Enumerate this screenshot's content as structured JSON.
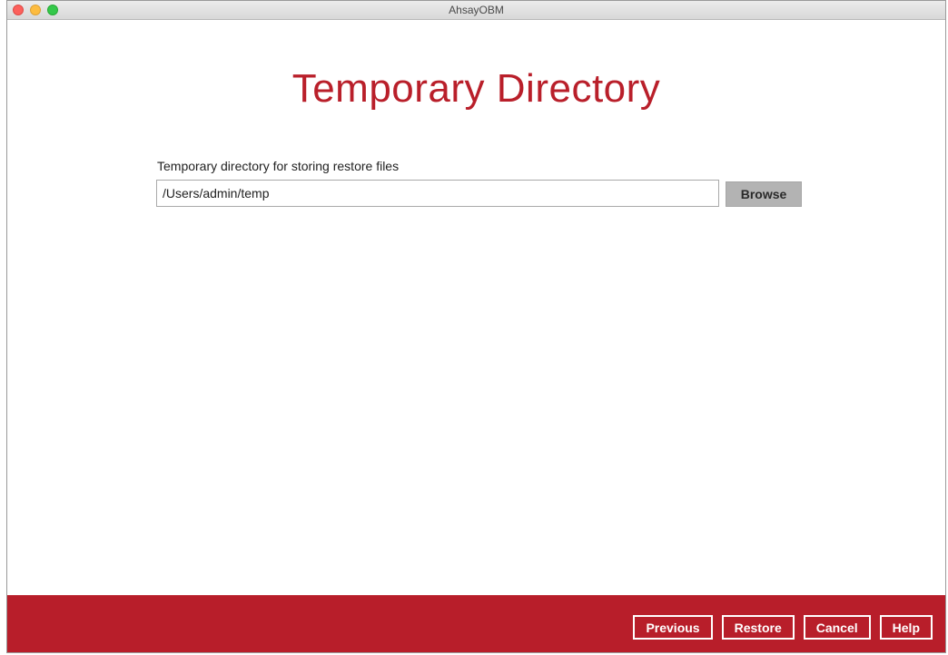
{
  "window": {
    "title": "AhsayOBM"
  },
  "page": {
    "title": "Temporary Directory"
  },
  "temp_dir": {
    "label": "Temporary directory for storing restore files",
    "value": "/Users/admin/temp",
    "browse_label": "Browse"
  },
  "footer": {
    "previous_label": "Previous",
    "restore_label": "Restore",
    "cancel_label": "Cancel",
    "help_label": "Help"
  },
  "colors": {
    "brand_red": "#b81e2a",
    "title_red": "#b91f2a",
    "browse_gray": "#b3b3b3"
  }
}
